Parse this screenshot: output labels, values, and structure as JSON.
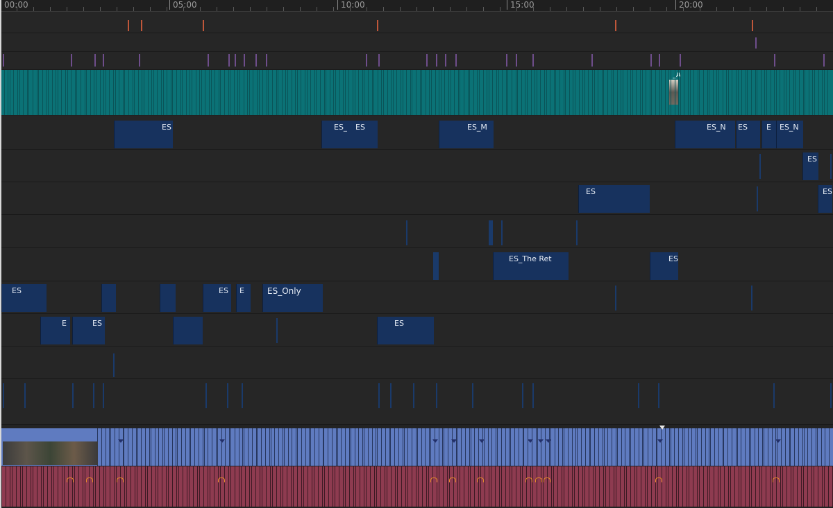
{
  "ruler": {
    "labels": [
      "00:00",
      "05:00",
      "10:00",
      "15:00",
      "20:00"
    ]
  },
  "clips": {
    "t4": [
      "ES",
      "ES_",
      "ES",
      "ES_M",
      "ES_N",
      "ES",
      "E",
      "ES_N"
    ],
    "t5": [
      "ES"
    ],
    "t6": [
      "ES",
      "ES"
    ],
    "t8": [
      "ES_The Ret",
      "ES"
    ],
    "t9": [
      "ES",
      "ES",
      "E",
      "ES_Only"
    ],
    "t10": [
      "E",
      "ES",
      "ES"
    ]
  },
  "video_clip_label": "_A",
  "colors": {
    "video_band": "#0b7276",
    "audio_blue": "#5f7bc0",
    "audio_red": "#8e3b50",
    "clip_blue": "#17325e",
    "marker_orange": "#c0573a",
    "marker_purple": "#6f4e8c"
  }
}
